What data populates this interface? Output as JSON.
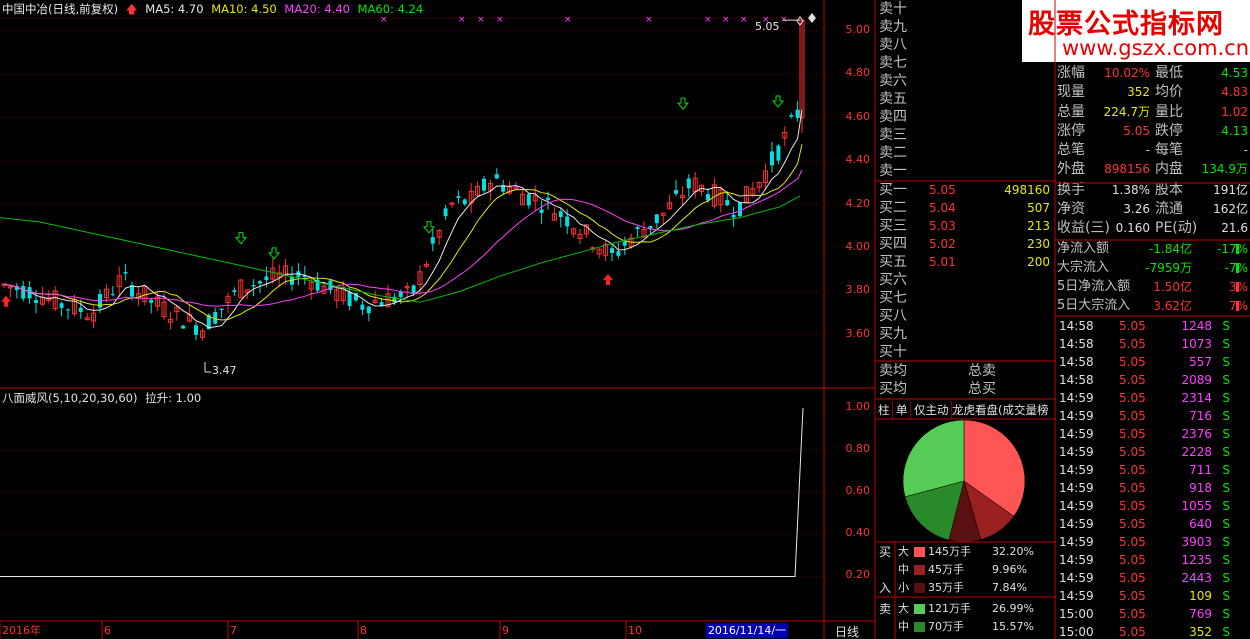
{
  "header": {
    "title": "中国中冶(日线,前复权)",
    "ma": [
      {
        "label": "MA5: 4.70",
        "color": "#e8e8e8"
      },
      {
        "label": "MA10: 4.50",
        "color": "#e8e800"
      },
      {
        "label": "MA20: 4.40",
        "color": "#ff40ff"
      },
      {
        "label": "MA60: 4.24",
        "color": "#00e600"
      }
    ]
  },
  "indicator": {
    "title": "八面威风(5,10,20,30,60)",
    "value_label": "拉升: 1.00"
  },
  "price_axis": [
    "5.00",
    "4.80",
    "4.60",
    "4.40",
    "4.20",
    "4.00",
    "3.80",
    "3.60"
  ],
  "indicator_axis": [
    "1.00",
    "0.80",
    "0.60",
    "0.40",
    "0.20"
  ],
  "annotations": {
    "high": "5.05",
    "low": "3.47"
  },
  "date_axis": {
    "labels": [
      "2016年",
      "6",
      "7",
      "8",
      "9",
      "10"
    ],
    "cursor": "2016/11/14/一",
    "period": "日线"
  },
  "order_book": {
    "sell": [
      "卖十",
      "卖九",
      "卖八",
      "卖七",
      "卖六",
      "卖五",
      "卖四",
      "卖三",
      "卖二",
      "卖一"
    ],
    "buy": [
      {
        "label": "买一",
        "price": "5.05",
        "vol": "498160"
      },
      {
        "label": "买二",
        "price": "5.04",
        "vol": "507"
      },
      {
        "label": "买三",
        "price": "5.03",
        "vol": "213"
      },
      {
        "label": "买四",
        "price": "5.02",
        "vol": "230"
      },
      {
        "label": "买五",
        "price": "5.01",
        "vol": "200"
      },
      {
        "label": "买六",
        "price": "",
        "vol": ""
      },
      {
        "label": "买七",
        "price": "",
        "vol": ""
      },
      {
        "label": "买八",
        "price": "",
        "vol": ""
      },
      {
        "label": "买九",
        "price": "",
        "vol": ""
      },
      {
        "label": "买十",
        "price": "",
        "vol": ""
      }
    ],
    "sell_avg": "卖均",
    "buy_avg": "买均",
    "total_sell": "总卖",
    "total_buy": "总买"
  },
  "watermark": {
    "title": "股票公式指标网",
    "url": "www.gszx.com.cn"
  },
  "stats": [
    {
      "l": "涨幅",
      "v": "10.02%",
      "vc": "#ff3232",
      "l2": "最低",
      "v2": "4.53",
      "v2c": "#00e600"
    },
    {
      "l": "现量",
      "v": "352",
      "vc": "#e8e800",
      "l2": "均价",
      "v2": "4.83",
      "v2c": "#ff3232"
    },
    {
      "l": "总量",
      "v": "224.7万",
      "vc": "#e8e800",
      "l2": "量比",
      "v2": "1.02",
      "v2c": "#ff3232"
    },
    {
      "l": "涨停",
      "v": "5.05",
      "vc": "#ff3232",
      "l2": "跌停",
      "v2": "4.13",
      "v2c": "#00e600"
    },
    {
      "l": "总笔",
      "v": "-",
      "vc": "#c0c0c0",
      "l2": "每笔",
      "v2": "-",
      "v2c": "#c0c0c0"
    },
    {
      "l": "外盘",
      "v": "898156",
      "vc": "#ff3232",
      "l2": "内盘",
      "v2": "134.9万",
      "v2c": "#00e600"
    },
    {
      "l": "换手",
      "v": "1.38%",
      "vc": "#e0e0e0",
      "l2": "股本",
      "v2": "191亿",
      "v2c": "#e0e0e0"
    },
    {
      "l": "净资",
      "v": "3.26",
      "vc": "#e0e0e0",
      "l2": "流通",
      "v2": "162亿",
      "v2c": "#e0e0e0"
    },
    {
      "l": "收益(三)",
      "v": "0.160",
      "vc": "#e0e0e0",
      "l2": "PE(动)",
      "v2": "21.6",
      "v2c": "#e0e0e0"
    }
  ],
  "flows": [
    {
      "l": "净流入额",
      "v": "-1.84亿",
      "pc": "-17%",
      "c": "#00e600"
    },
    {
      "l": "大宗流入",
      "v": "-7959万",
      "pc": "-7%",
      "c": "#00e600"
    },
    {
      "l": "5日净流入额",
      "v": "1.50亿",
      "pc": "3%",
      "c": "#ff3232"
    },
    {
      "l": "5日大宗流入",
      "v": "3.62亿",
      "pc": "7%",
      "c": "#ff3232"
    }
  ],
  "ticks": [
    {
      "t": "14:58",
      "p": "5.05",
      "v": "1248",
      "s": "S"
    },
    {
      "t": "14:58",
      "p": "5.05",
      "v": "1073",
      "s": "S"
    },
    {
      "t": "14:58",
      "p": "5.05",
      "v": "557",
      "s": "S"
    },
    {
      "t": "14:58",
      "p": "5.05",
      "v": "2089",
      "s": "S"
    },
    {
      "t": "14:59",
      "p": "5.05",
      "v": "2314",
      "s": "S"
    },
    {
      "t": "14:59",
      "p": "5.05",
      "v": "716",
      "s": "S"
    },
    {
      "t": "14:59",
      "p": "5.05",
      "v": "2376",
      "s": "S"
    },
    {
      "t": "14:59",
      "p": "5.05",
      "v": "2228",
      "s": "S"
    },
    {
      "t": "14:59",
      "p": "5.05",
      "v": "711",
      "s": "S"
    },
    {
      "t": "14:59",
      "p": "5.05",
      "v": "918",
      "s": "S"
    },
    {
      "t": "14:59",
      "p": "5.05",
      "v": "1055",
      "s": "S"
    },
    {
      "t": "14:59",
      "p": "5.05",
      "v": "640",
      "s": "S"
    },
    {
      "t": "14:59",
      "p": "5.05",
      "v": "3903",
      "s": "S"
    },
    {
      "t": "14:59",
      "p": "5.05",
      "v": "1235",
      "s": "S"
    },
    {
      "t": "14:59",
      "p": "5.05",
      "v": "2443",
      "s": "S"
    },
    {
      "t": "14:59",
      "p": "5.05",
      "v": "109",
      "s": "S",
      "vc": "#e8e800"
    },
    {
      "t": "15:00",
      "p": "5.05",
      "v": "769",
      "s": "S"
    },
    {
      "t": "15:00",
      "p": "5.05",
      "v": "352",
      "s": "S",
      "vc": "#e8e800"
    }
  ],
  "tabs": [
    "柱",
    "单",
    "仅主动",
    "龙虎看盘(成交量榜"
  ],
  "capital": {
    "buy_label": "买",
    "in_label": "入",
    "sell_label": "卖",
    "rows": [
      {
        "side": "buy",
        "size": "大",
        "amount": "145万手",
        "pct": "32.20%",
        "color": "#ff5555",
        "value": 32.2
      },
      {
        "side": "buy",
        "size": "中",
        "amount": "45万手",
        "pct": "9.96%",
        "color": "#9b2020",
        "value": 9.96
      },
      {
        "side": "buy",
        "size": "小",
        "amount": "35万手",
        "pct": "7.84%",
        "color": "#5a1010",
        "value": 7.84
      },
      {
        "side": "sell",
        "size": "大",
        "amount": "121万手",
        "pct": "26.99%",
        "color": "#55cc55",
        "value": 26.99
      },
      {
        "side": "sell",
        "size": "中",
        "amount": "70万手",
        "pct": "15.57%",
        "color": "#2a8a2a",
        "value": 15.57
      }
    ]
  }
}
